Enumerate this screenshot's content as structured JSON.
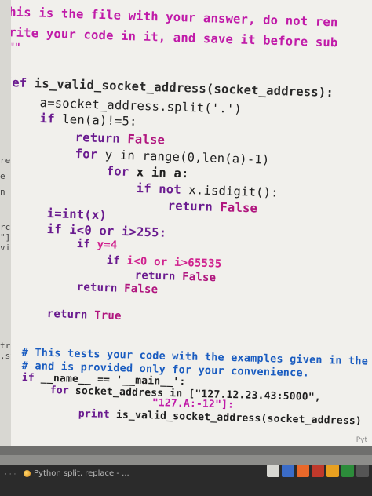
{
  "left_gutter": [
    "re",
    "e",
    "n",
    "rc",
    "\"]",
    "vi",
    "tr(",
    ",st"
  ],
  "code": {
    "doc1": "This is the file with your answer, do not ren",
    "doc2": "Write your code in it, and save it before sub",
    "doc3": "\"\"\"",
    "l_def_kw": "def ",
    "l_def_rest": "is_valid_socket_address(socket_address):",
    "l_split": "a=socket_address.split('.')",
    "l_if1_kw": "if ",
    "l_if1_rest": "len(a)!=5:",
    "l_ret1_kw": "return ",
    "l_ret1_val": "False",
    "l_for1_kw": "for ",
    "l_for1_rest": "y in range(0,len(a)-1)",
    "l_for2_kw": "for ",
    "l_for2_rest": "x in a:",
    "l_if2_kw": "if not ",
    "l_if2_rest": "x.isdigit():",
    "l_ret2_kw": "return ",
    "l_ret2_val": "False",
    "l_int": "i=int(x)",
    "l_if3_kw": "if ",
    "l_if3_rest": "i<0 or i>255:",
    "l_if4_kw": "if ",
    "l_if4_rest": "y=4",
    "l_if5_kw": "if ",
    "l_if5_rest": "i<0 or i>65535",
    "l_ret3_kw": "return ",
    "l_ret3_val": "False",
    "l_ret4_kw": "return ",
    "l_ret4_val": "False",
    "l_ret5_kw": "return ",
    "l_ret5_val": "True",
    "c1": "# This tests your code with the examples given in the",
    "c2": "# and is provided only for your convenience.",
    "main_kw": "if ",
    "main_rest": "__name__ == '__main__':",
    "for_main_kw": "for ",
    "for_main_rest": "socket_address in [\"127.12.23.43:5000\",",
    "for_main_cont": "\"127.A:-12\"]:",
    "print_kw": "print ",
    "print_rest": "is_valid_socket_address(socket_address)"
  },
  "status_right": "Pyt",
  "taskbar": {
    "task_label": "Python split, replace - ...",
    "dots": "· · ·"
  },
  "tray_colors": [
    "#d7d7d2",
    "#3b6cc8",
    "#e9682a",
    "#c0392b",
    "#e8a020",
    "#2c8c3a",
    "#555555"
  ]
}
